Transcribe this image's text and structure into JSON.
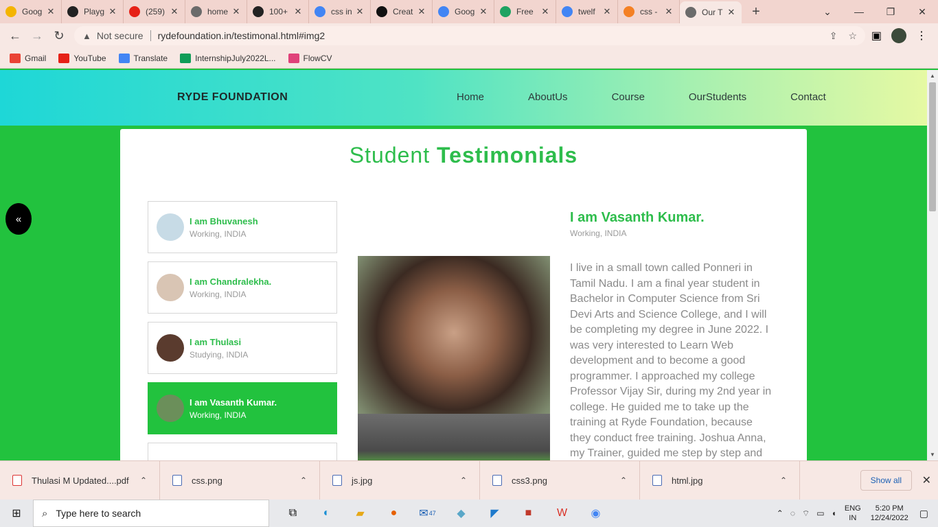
{
  "browser": {
    "tabs": [
      {
        "label": "Goog",
        "icon": "bulb-icon",
        "color": "#f4b400"
      },
      {
        "label": "Playg",
        "icon": "openai-icon",
        "color": "#222222"
      },
      {
        "label": "(259)",
        "icon": "youtube-icon",
        "color": "#e62117"
      },
      {
        "label": "home",
        "icon": "globe-icon",
        "color": "#6b6b6b"
      },
      {
        "label": "100+",
        "icon": "bookmark-icon",
        "color": "#222222"
      },
      {
        "label": "css in",
        "icon": "google-icon",
        "color": "#4285f4"
      },
      {
        "label": "Creat",
        "icon": "f-icon",
        "color": "#111111"
      },
      {
        "label": "Goog",
        "icon": "translate-icon",
        "color": "#4285f4"
      },
      {
        "label": "Free",
        "icon": "refresh-icon",
        "color": "#1ea362"
      },
      {
        "label": "twelf",
        "icon": "google-icon",
        "color": "#4285f4"
      },
      {
        "label": "css -",
        "icon": "stack-icon",
        "color": "#f48024"
      },
      {
        "label": "Our T",
        "icon": "globe-icon",
        "color": "#6b6b6b",
        "active": true
      }
    ],
    "not_secure": "Not secure",
    "url": "rydefoundation.in/testimonal.html#img2",
    "bookmarks": [
      {
        "label": "Gmail",
        "color": "#ea4335"
      },
      {
        "label": "YouTube",
        "color": "#e62117"
      },
      {
        "label": "Translate",
        "color": "#4285f4"
      },
      {
        "label": "InternshipJuly2022L...",
        "color": "#0f9d58"
      },
      {
        "label": "FlowCV",
        "color": "#e0427a"
      }
    ]
  },
  "site": {
    "brand": "RYDE FOUNDATION",
    "menu": [
      "Home",
      "AboutUs",
      "Course",
      "OurStudents",
      "Contact"
    ],
    "heading_light": "Student",
    "heading_bold": "Testimonials",
    "prev_button": "«",
    "students": [
      {
        "name": "I am Bhuvanesh",
        "status": "Working, INDIA",
        "avatar_color": "#c7dbe6"
      },
      {
        "name": "I am Chandralekha.",
        "status": "Working, INDIA",
        "avatar_color": "#d9c5b4"
      },
      {
        "name": "I am Thulasi",
        "status": "Studying, INDIA",
        "avatar_color": "#5a3b2e"
      },
      {
        "name": "I am Vasanth Kumar.",
        "status": "Working, INDIA",
        "avatar_color": "#6b8f5a",
        "active": true
      }
    ],
    "detail": {
      "name": "I am Vasanth Kumar.",
      "status": "Working, INDIA",
      "text": "I live in a small town called Ponneri in Tamil Nadu. I am a final year student in Bachelor in Computer Science from Sri Devi Arts and Science College, and I will be completing my degree in June 2022. I was very interested to Learn Web development and to become a good programmer. I approached my college Professor Vijay Sir, during my 2nd year in college. He guided me to take up the training at Ryde Foundation, because they conduct free training. Joshua Anna, my Trainer, guided me step by step and"
    }
  },
  "downloads": {
    "items": [
      {
        "name": "Thulasi M Updated....pdf",
        "type": "pdf"
      },
      {
        "name": "css.png",
        "type": "png"
      },
      {
        "name": "js.jpg",
        "type": "jpg"
      },
      {
        "name": "css3.png",
        "type": "png"
      },
      {
        "name": "html.jpg",
        "type": "jpg"
      }
    ],
    "show_all": "Show all"
  },
  "taskbar": {
    "search_placeholder": "Type here to search",
    "mail_badge": "47",
    "lang_top": "ENG",
    "lang_bottom": "IN",
    "time": "5:20 PM",
    "date": "12/24/2022"
  }
}
